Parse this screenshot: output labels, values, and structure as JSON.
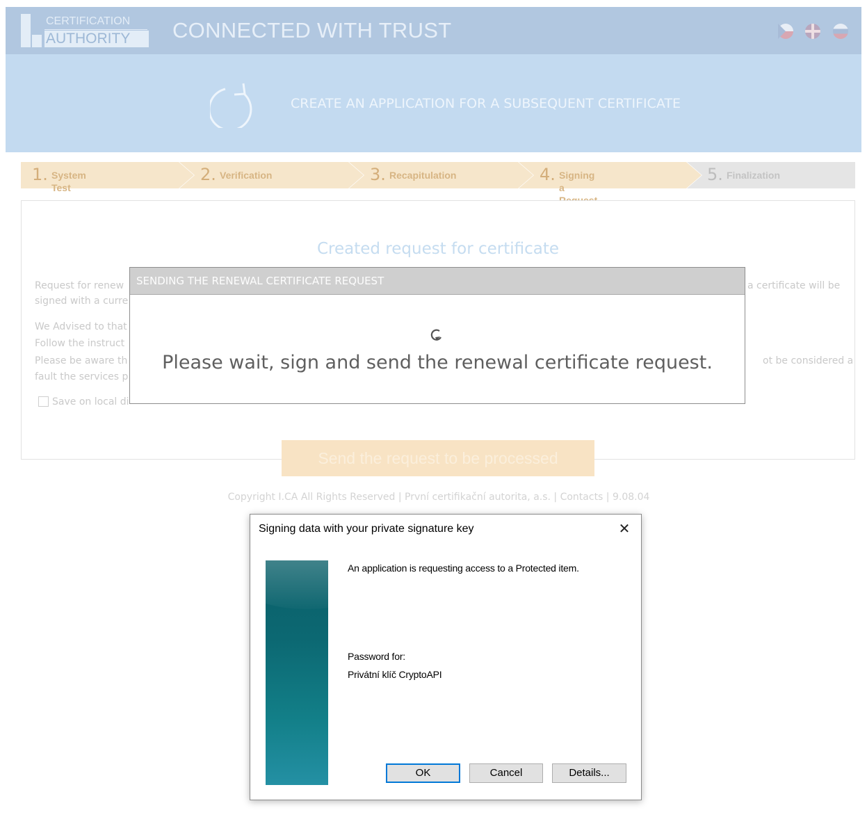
{
  "header": {
    "logo_line1": "CERTIFICATION",
    "logo_line2": "AUTHORITY",
    "tagline": "CONNECTED WITH TRUST",
    "languages": [
      "Czech",
      "English",
      "Russian"
    ]
  },
  "banner": {
    "icon": "refresh-icon",
    "title": "CREATE AN APPLICATION FOR A SUBSEQUENT CERTIFICATE"
  },
  "stepper": [
    {
      "num": "1.",
      "label": "System Test",
      "state": "done"
    },
    {
      "num": "2.",
      "label": "Verification",
      "state": "done"
    },
    {
      "num": "3.",
      "label": "Recapitulation",
      "state": "done"
    },
    {
      "num": "4.",
      "label": "Signing a Request",
      "state": "active"
    },
    {
      "num": "5.",
      "label": "Finalization",
      "state": "pending"
    }
  ],
  "card": {
    "title": "Created request for certificate",
    "lines_left": [
      "Request for renew",
      "signed with a curre",
      "We Advised to that",
      "Follow the instruct",
      "Please be aware th",
      "fault the services p"
    ],
    "lines_right": [
      "a certificate will be",
      "ot be considered a"
    ],
    "checkbox_label": "Save on local di"
  },
  "send_button": "Send the request to be processed",
  "footer": "Copyright I.CA All Rights Reserved |  První certifikační autorita, a.s.  |  Contacts  | 9.08.04",
  "web_modal": {
    "title": "SENDING THE RENEWAL CERTIFICATE REQUEST",
    "message": "Please wait, sign and send the renewal certificate request."
  },
  "win_dialog": {
    "title": "Signing data with your private signature key",
    "close": "✕",
    "message": "An application is requesting access to a Protected item.",
    "password_for_label": "Password for:",
    "key_name": "Privátní klíč CryptoAPI",
    "buttons": {
      "ok": "OK",
      "cancel": "Cancel",
      "details": "Details..."
    }
  },
  "colors": {
    "header_bg": "#b1c7e0",
    "banner_bg": "#c3daf0",
    "step_done": "#f6e6cb",
    "step_pending": "#e5e5e5",
    "send_button_bg": "#f8e3c4",
    "dialog_default_button_border": "#0078d7"
  }
}
